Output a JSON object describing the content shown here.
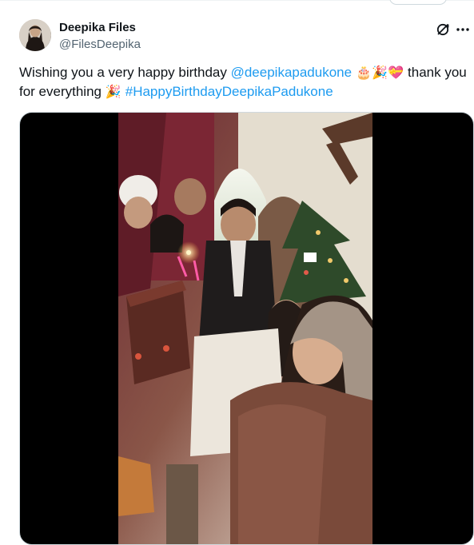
{
  "author": {
    "display_name": "Deepika Files",
    "handle": "@FilesDeepika",
    "avatar_icon": "profile-photo"
  },
  "actions": {
    "grok_icon": "grok-icon",
    "more_icon": "more-options-icon"
  },
  "tweet": {
    "text_before": "Wishing you a very happy birthday ",
    "mention": "@deepikapadukone",
    "emojis_1": " 🎂🎉💝 ",
    "text_middle": "thank you for everything ",
    "emoji_2": "🎉 ",
    "hashtag": "#HappyBirthdayDeepikaPadukone"
  },
  "media": {
    "type": "video",
    "description_icon": "video-thumbnail"
  },
  "colors": {
    "link": "#1d9bf0",
    "text": "#0f1419",
    "secondary": "#536471"
  }
}
